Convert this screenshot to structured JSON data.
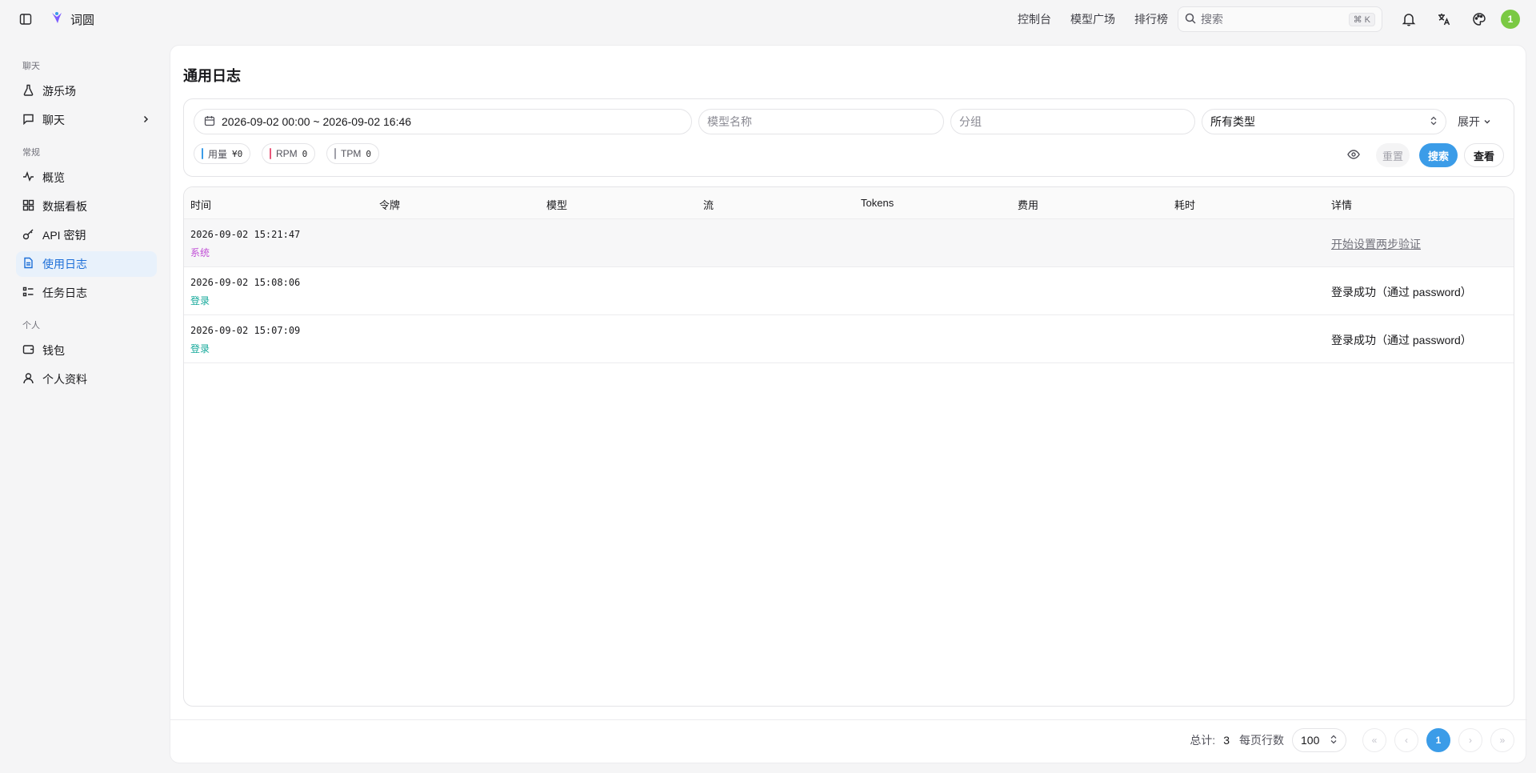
{
  "app": {
    "name": "词圆"
  },
  "topnav": {
    "links": [
      "控制台",
      "模型广场",
      "排行榜"
    ],
    "search_placeholder": "搜索",
    "shortcut": "⌘ K",
    "avatar_initial": "1"
  },
  "sidebar": {
    "groups": [
      {
        "title": "聊天",
        "items": [
          {
            "label": "游乐场",
            "icon": "flask-icon"
          },
          {
            "label": "聊天",
            "icon": "message-icon",
            "has_chevron": true
          }
        ]
      },
      {
        "title": "常规",
        "items": [
          {
            "label": "概览",
            "icon": "activity-icon"
          },
          {
            "label": "数据看板",
            "icon": "dashboard-icon"
          },
          {
            "label": "API 密钥",
            "icon": "key-icon"
          },
          {
            "label": "使用日志",
            "icon": "document-icon",
            "active": true
          },
          {
            "label": "任务日志",
            "icon": "checklist-icon"
          }
        ]
      },
      {
        "title": "个人",
        "items": [
          {
            "label": "钱包",
            "icon": "wallet-icon"
          },
          {
            "label": "个人资料",
            "icon": "user-icon"
          }
        ]
      }
    ]
  },
  "page": {
    "title": "通用日志"
  },
  "filters": {
    "date_range": "2026-09-02 00:00 ~ 2026-09-02 16:46",
    "model_placeholder": "模型名称",
    "group_placeholder": "分组",
    "type_selected": "所有类型",
    "expand_label": "展开",
    "stats": [
      {
        "label": "用量",
        "value": "¥0",
        "color": "#3b9ce8"
      },
      {
        "label": "RPM",
        "value": "0",
        "color": "#e8577a"
      },
      {
        "label": "TPM",
        "value": "0",
        "color": "#a1a1aa"
      }
    ],
    "reset_label": "重置",
    "search_label": "搜索",
    "view_label": "查看"
  },
  "table": {
    "columns": [
      "时间",
      "令牌",
      "模型",
      "流",
      "Tokens",
      "费用",
      "耗时",
      "详情"
    ],
    "rows": [
      {
        "time": "2026-09-02 15:21:47",
        "type": "系统",
        "type_color": "#c04fd6",
        "detail": "开始设置两步验证",
        "detail_is_link": true
      },
      {
        "time": "2026-09-02 15:08:06",
        "type": "登录",
        "type_color": "#14a89a",
        "detail": "登录成功（通过 password）",
        "detail_is_link": false
      },
      {
        "time": "2026-09-02 15:07:09",
        "type": "登录",
        "type_color": "#14a89a",
        "detail": "登录成功（通过 password）",
        "detail_is_link": false
      }
    ]
  },
  "pagination": {
    "total_label": "总计:",
    "total": "3",
    "per_page_label": "每页行数",
    "per_page": "100",
    "current_page": "1",
    "first_symbol": "«",
    "prev_symbol": "‹",
    "next_symbol": "›",
    "last_symbol": "»"
  }
}
